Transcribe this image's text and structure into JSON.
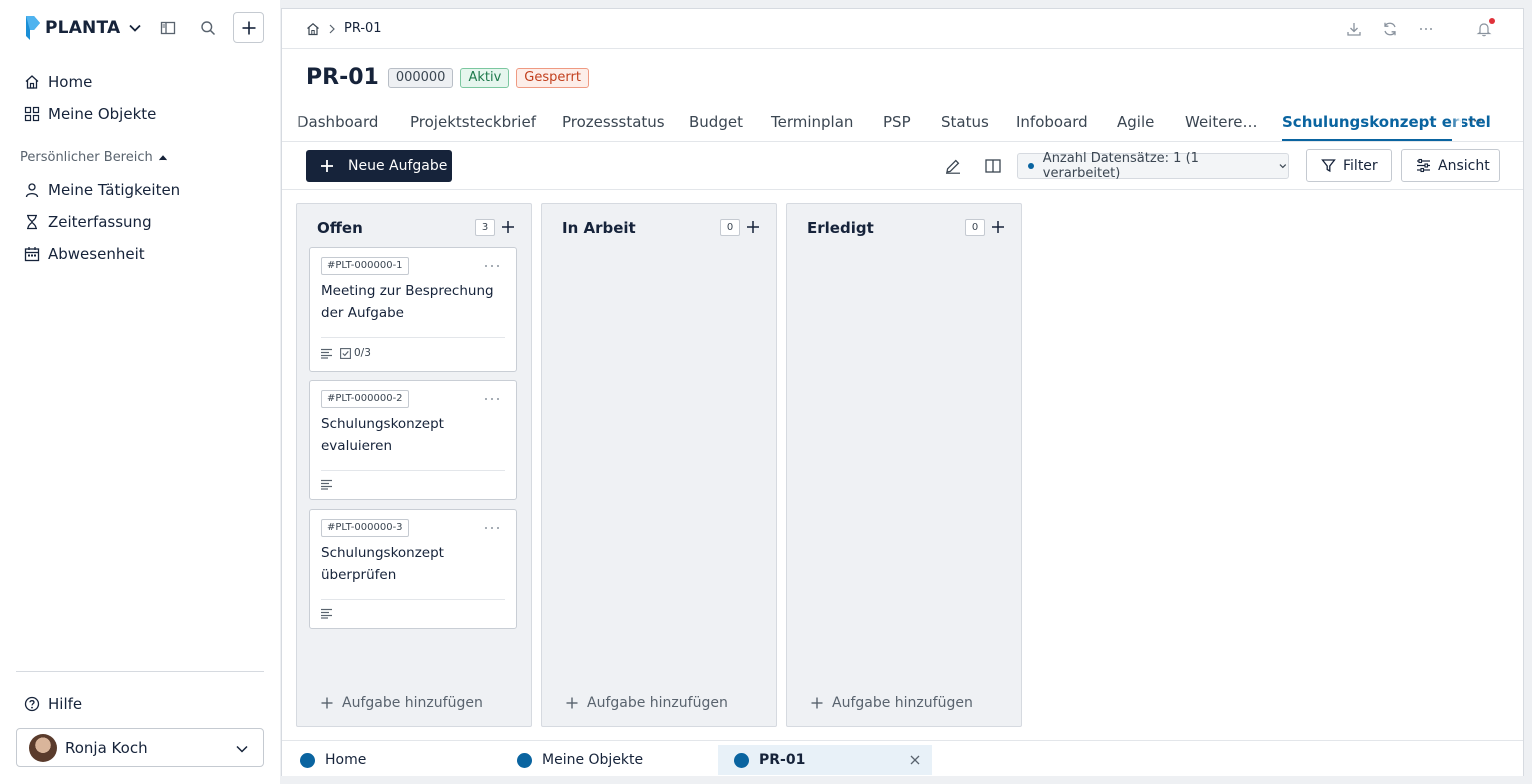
{
  "brand": {
    "name": "PLANTA",
    "accent": "#0a64a0",
    "dark": "#16233a"
  },
  "sidebar": {
    "nav": [
      {
        "label": "Home",
        "icon": "home-icon"
      },
      {
        "label": "Meine Objekte",
        "icon": "grid-icon"
      }
    ],
    "section_label": "Persönlicher Bereich",
    "personal": [
      {
        "label": "Meine Tätigkeiten",
        "icon": "person-icon"
      },
      {
        "label": "Zeiterfassung",
        "icon": "hourglass-icon"
      },
      {
        "label": "Abwesenheit",
        "icon": "calendar-icon"
      }
    ],
    "help_label": "Hilfe",
    "user_name": "Ronja Koch"
  },
  "breadcrumb": {
    "current": "PR-01"
  },
  "page": {
    "title": "PR-01",
    "badges": {
      "id": "000000",
      "status": "Aktiv",
      "lock": "Gesperrt"
    }
  },
  "tabs": [
    "Dashboard",
    "Projektsteckbrief",
    "Prozessstatus",
    "Budget",
    "Terminplan",
    "PSP",
    "Status",
    "Infoboard",
    "Agile",
    "Weitere…",
    "Schulungskonzept erstel"
  ],
  "tabs_more": "···",
  "toolbar": {
    "new_task": "Neue Aufgabe",
    "records": "Anzahl Datensätze: 1 (1 verarbeitet)",
    "filter": "Filter",
    "view": "Ansicht"
  },
  "board": {
    "add_task_label": "Aufgabe hinzufügen",
    "columns": [
      {
        "title": "Offen",
        "count": "3",
        "cards": [
          {
            "id": "#PLT-000000-1",
            "title": "Meeting zur Besprechung der Aufgabe",
            "checklist": "0/3"
          },
          {
            "id": "#PLT-000000-2",
            "title": "Schulungskonzept evaluieren"
          },
          {
            "id": "#PLT-000000-3",
            "title": "Schulungskonzept überprüfen"
          }
        ]
      },
      {
        "title": "In Arbeit",
        "count": "0",
        "cards": []
      },
      {
        "title": "Erledigt",
        "count": "0",
        "cards": []
      }
    ]
  },
  "bottom_tabs": [
    {
      "label": "Home"
    },
    {
      "label": "Meine Objekte"
    },
    {
      "label": "PR-01",
      "active": true
    }
  ]
}
